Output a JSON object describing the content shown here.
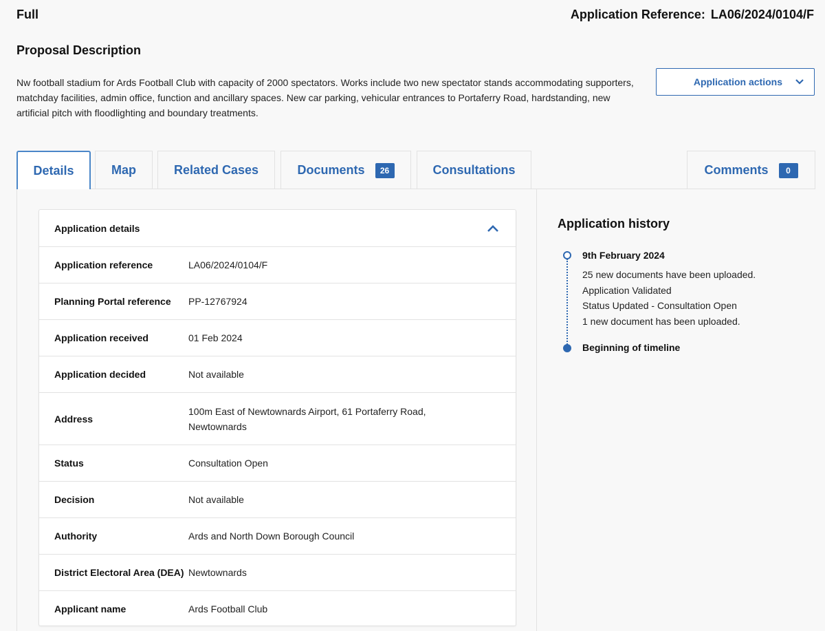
{
  "header": {
    "application_type": "Full",
    "reference_label": "Application Reference:",
    "reference_value": "LA06/2024/0104/F"
  },
  "proposal": {
    "heading": "Proposal Description",
    "text": "Nw football stadium for Ards Football Club with capacity of 2000 spectators. Works include two new spectator stands accommodating supporters, matchday facilities, admin office, function and ancillary spaces. New car parking, vehicular entrances to Portaferry Road, hardstanding, new artificial pitch with floodlighting and boundary treatments."
  },
  "actions": {
    "label": "Application actions",
    "icon": "chevron-down-icon"
  },
  "tabs": [
    {
      "label": "Details",
      "active": true
    },
    {
      "label": "Map"
    },
    {
      "label": "Related Cases"
    },
    {
      "label": "Documents",
      "badge": "26"
    },
    {
      "label": "Consultations"
    },
    {
      "label": "Comments",
      "badge": "0"
    }
  ],
  "details_card": {
    "title": "Application details",
    "collapse_icon": "chevron-up-icon",
    "rows": [
      {
        "label": "Application reference",
        "value": "LA06/2024/0104/F"
      },
      {
        "label": "Planning Portal reference",
        "value": "PP-12767924"
      },
      {
        "label": "Application received",
        "value": "01 Feb 2024"
      },
      {
        "label": "Application decided",
        "value": "Not available"
      },
      {
        "label": "Address",
        "value": "100m East of Newtownards Airport, 61 Portaferry Road, Newtownards"
      },
      {
        "label": "Status",
        "value": "Consultation Open"
      },
      {
        "label": "Decision",
        "value": "Not available"
      },
      {
        "label": "Authority",
        "value": "Ards and North Down Borough Council"
      },
      {
        "label": "District Electoral Area (DEA)",
        "value": "Newtownards"
      },
      {
        "label": "Applicant name",
        "value": "Ards Football Club"
      }
    ]
  },
  "history": {
    "title": "Application history",
    "entries": [
      {
        "date": "9th February 2024",
        "events": [
          "25 new documents have been uploaded.",
          "Application Validated",
          "Status Updated - Consultation Open",
          "1 new document has been uploaded."
        ]
      }
    ],
    "beginning_label": "Beginning of timeline"
  },
  "colors": {
    "accent": "#2e68b1",
    "border": "#e2e2e2",
    "background": "#f8f8f8"
  }
}
